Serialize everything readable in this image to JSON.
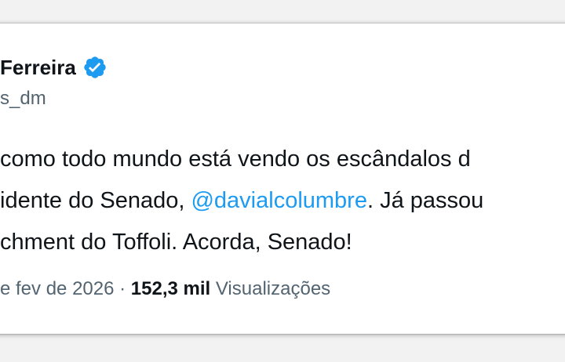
{
  "author": {
    "display_name": "Ferreira",
    "handle": "s_dm"
  },
  "tweet": {
    "line1": "como todo mundo está vendo os escândalos d",
    "line2_prefix": "idente do Senado, ",
    "mention": "@davialcolumbre",
    "line2_suffix": ". Já passou",
    "line3": "chment do Toffoli. Acorda, Senado!"
  },
  "meta": {
    "date": "e fev de 2026",
    "separator": " · ",
    "views_count": "152,3 mil",
    "views_label": " Visualizações"
  },
  "colors": {
    "verified": "#1d9bf0",
    "mention": "#1d9bf0",
    "text": "#0f1419",
    "muted": "#536471"
  },
  "icons": {
    "verified": "verified-badge-icon"
  }
}
